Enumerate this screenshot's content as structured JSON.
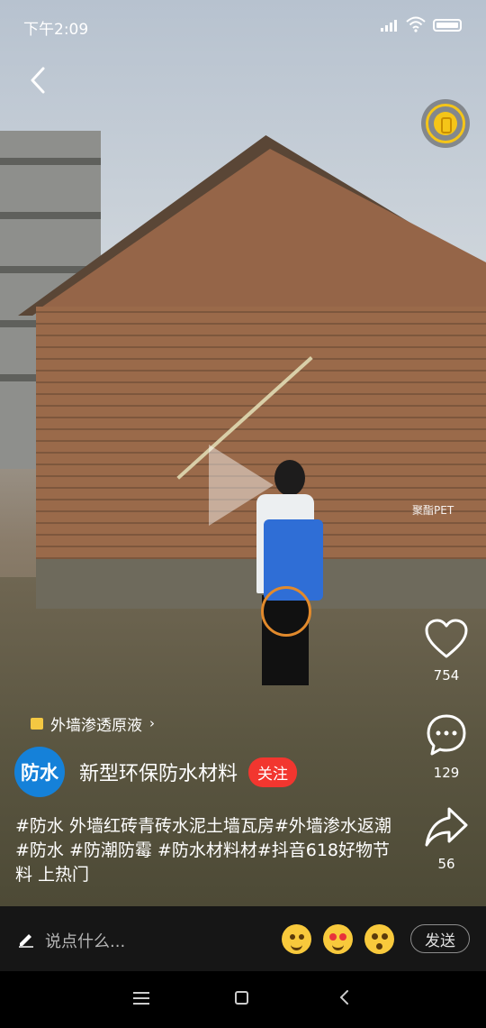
{
  "status_bar": {
    "time": "下午2:09"
  },
  "video": {
    "watermark": "聚酯PET"
  },
  "tag": {
    "label": "外墙渗透原液"
  },
  "author": {
    "avatar_text": "防水",
    "name": "新型环保防水材料",
    "follow_label": "关注"
  },
  "caption": "#防水 外墙红砖青砖水泥土墙瓦房#外墙渗水返潮 #防水 #防潮防霉 #防水材料材#抖音618好物节料 上热门",
  "actions": {
    "likes": "754",
    "comments": "129",
    "shares": "56"
  },
  "comment_bar": {
    "placeholder": "说点什么...",
    "send_label": "发送"
  },
  "colors": {
    "follow": "#f2362f",
    "avatar": "#1581d9",
    "coin": "#f5c518"
  }
}
